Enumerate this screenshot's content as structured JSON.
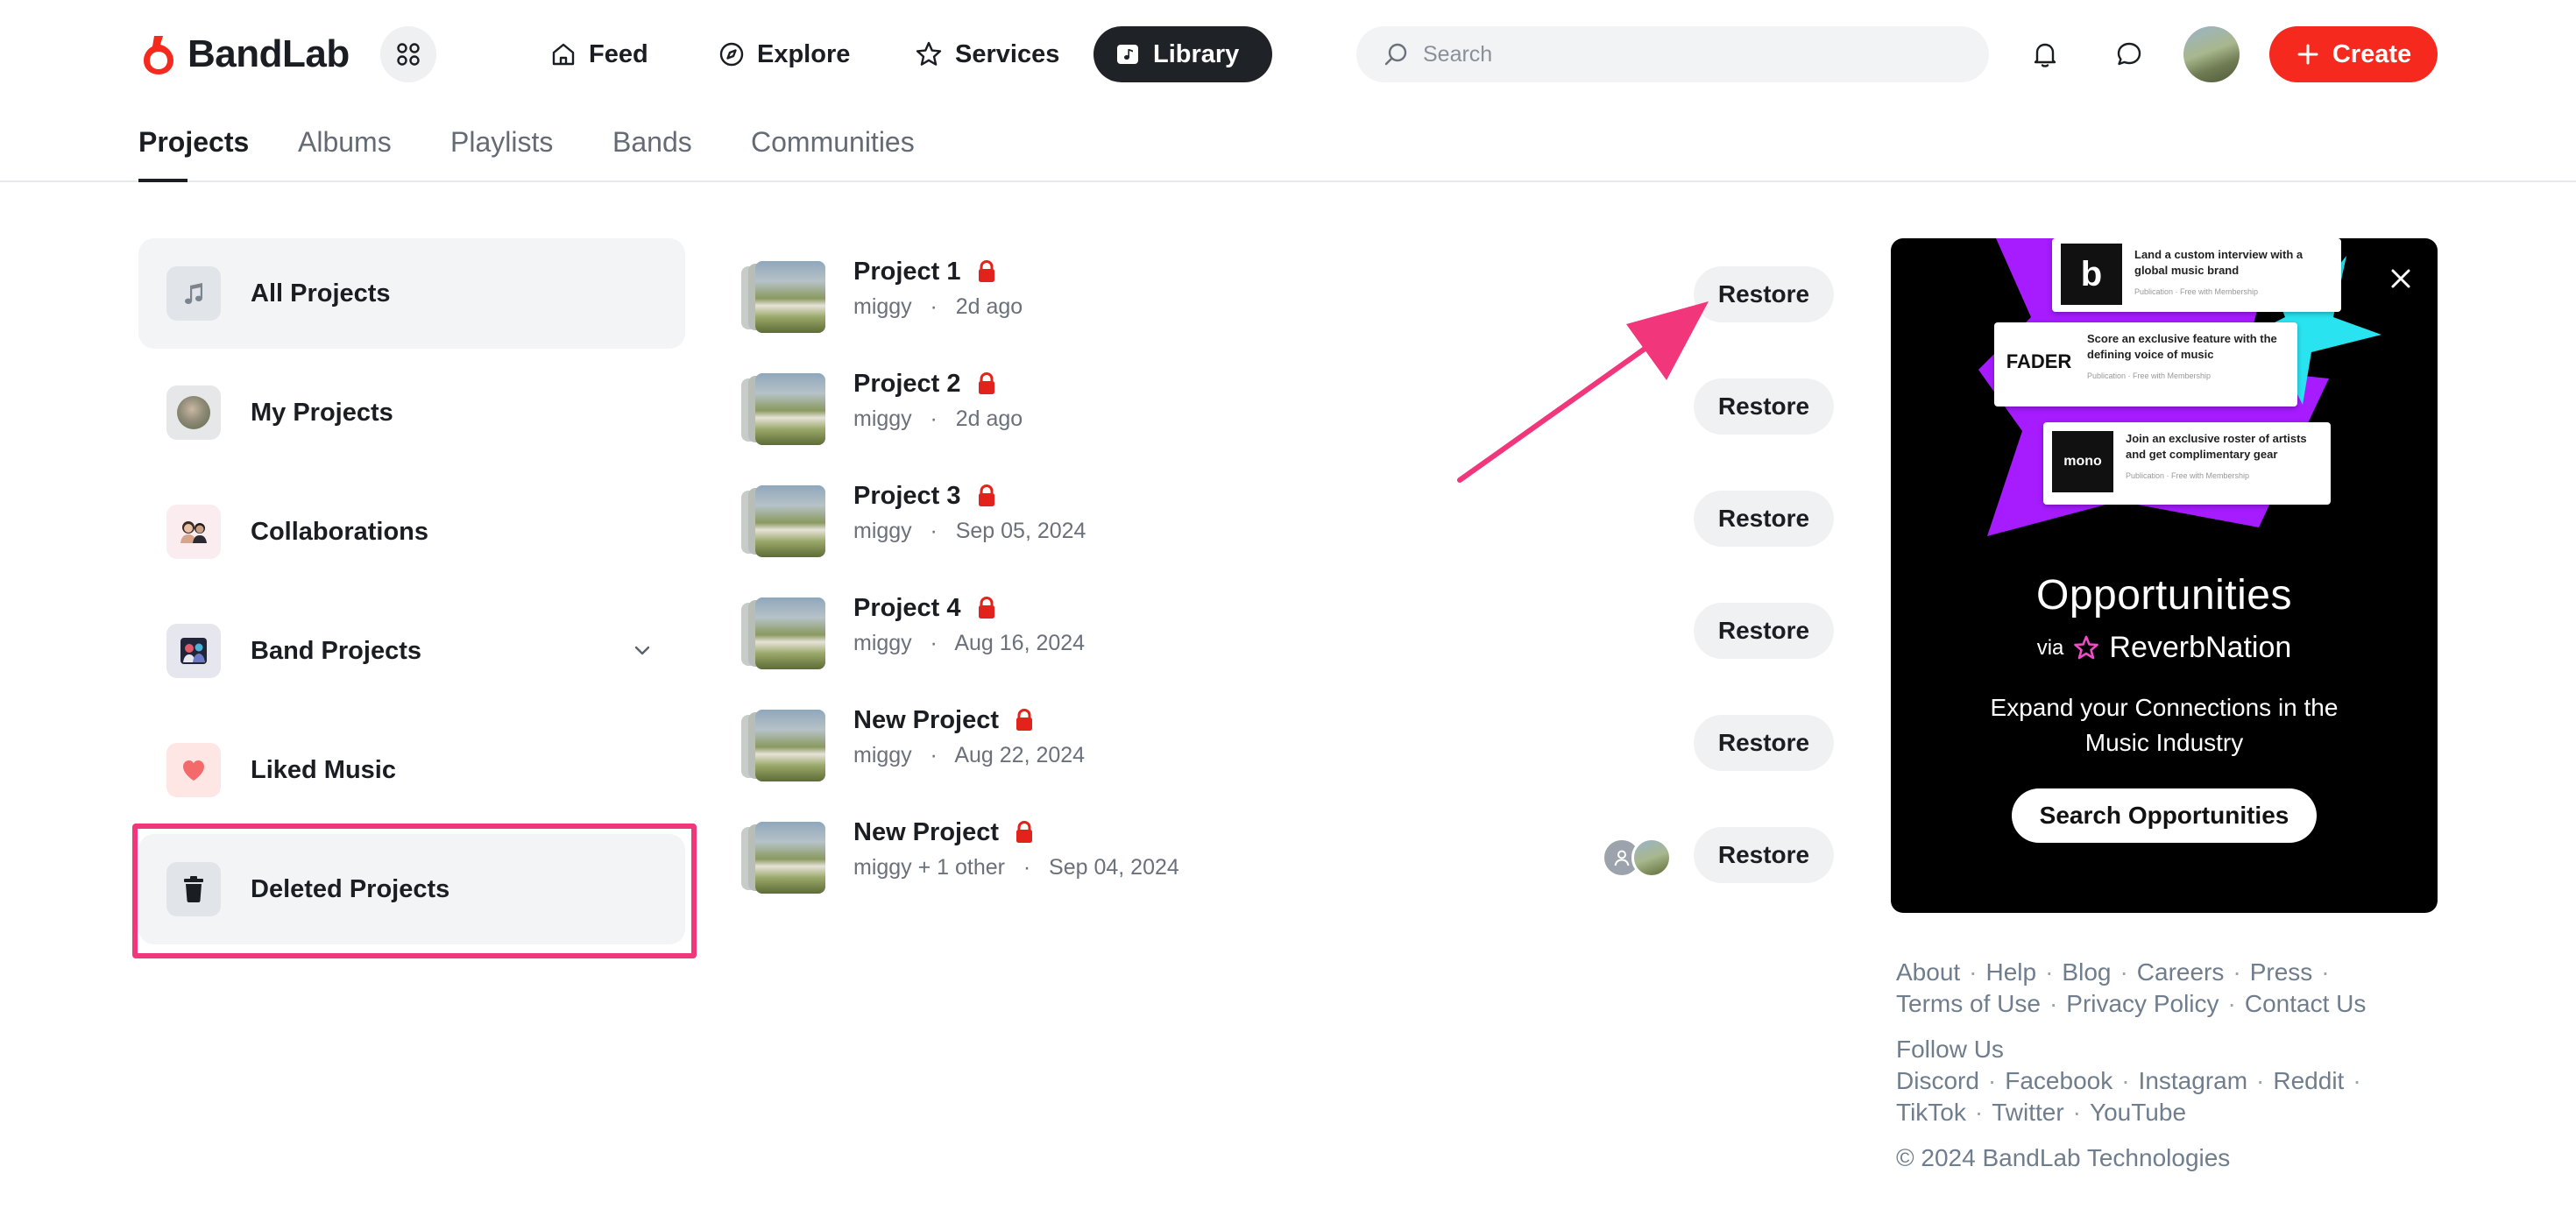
{
  "app": {
    "brand": "BandLab",
    "brand_color": "#f5291d"
  },
  "nav": {
    "items": [
      {
        "label": "Feed",
        "icon": "home-icon",
        "active": false
      },
      {
        "label": "Explore",
        "icon": "compass-icon",
        "active": false
      },
      {
        "label": "Services",
        "icon": "star-icon",
        "active": false
      },
      {
        "label": "Library",
        "icon": "library-icon",
        "active": true
      }
    ],
    "search_placeholder": "Search",
    "create_label": "Create"
  },
  "tabs": [
    {
      "label": "Projects",
      "active": true
    },
    {
      "label": "Albums",
      "active": false
    },
    {
      "label": "Playlists",
      "active": false
    },
    {
      "label": "Bands",
      "active": false
    },
    {
      "label": "Communities",
      "active": false
    }
  ],
  "sidebar": {
    "items": [
      {
        "label": "All Projects",
        "icon": "music-note-icon",
        "selected": true
      },
      {
        "label": "My Projects",
        "icon": "user-avatar-icon",
        "selected": false
      },
      {
        "label": "Collaborations",
        "icon": "collaborators-icon",
        "selected": false
      },
      {
        "label": "Band Projects",
        "icon": "band-icon",
        "selected": false,
        "expandable": true
      },
      {
        "label": "Liked Music",
        "icon": "heart-icon",
        "selected": false
      },
      {
        "label": "Deleted Projects",
        "icon": "trash-icon",
        "selected": false,
        "highlighted": true
      }
    ]
  },
  "projects": [
    {
      "title": "Project 1",
      "owner": "miggy",
      "date": "2d ago",
      "private": true,
      "restore_label": "Restore"
    },
    {
      "title": "Project 2",
      "owner": "miggy",
      "date": "2d ago",
      "private": true,
      "restore_label": "Restore"
    },
    {
      "title": "Project 3",
      "owner": "miggy",
      "date": "Sep 05, 2024",
      "private": true,
      "restore_label": "Restore"
    },
    {
      "title": "Project 4",
      "owner": "miggy",
      "date": "Aug 16, 2024",
      "private": true,
      "restore_label": "Restore"
    },
    {
      "title": "New Project",
      "owner": "miggy",
      "date": "Aug 22, 2024",
      "private": true,
      "restore_label": "Restore"
    },
    {
      "title": "New Project",
      "owner": "miggy + 1 other",
      "date": "Sep 04, 2024",
      "private": true,
      "restore_label": "Restore",
      "collaborators": true
    }
  ],
  "meta_separator": "·",
  "promo": {
    "cards": [
      {
        "logo": "b",
        "text": "Land a custom interview with a global music brand",
        "sub": "Publication · Free with Membership"
      },
      {
        "logo": "FADER",
        "text": "Score an exclusive feature with the defining voice of music",
        "sub": "Publication · Free with Membership"
      },
      {
        "logo": "mono",
        "text": "Join an exclusive roster of artists and get complimentary gear",
        "sub": "Publication · Free with Membership"
      }
    ],
    "title": "Opportunities",
    "via": "via",
    "via_brand": "ReverbNation",
    "description": "Expand your Connections in the Music Industry",
    "button_label": "Search Opportunities",
    "accent_purple": "#a61bff",
    "accent_cyan": "#29e3f0",
    "accent_pink": "#f04cc8"
  },
  "footer": {
    "row1": [
      "About",
      "Help",
      "Blog",
      "Careers",
      "Press"
    ],
    "row2": [
      "Terms of Use",
      "Privacy Policy",
      "Contact Us"
    ],
    "follow_label": "Follow Us",
    "row3": [
      "Discord",
      "Facebook",
      "Instagram",
      "Reddit"
    ],
    "row4": [
      "TikTok",
      "Twitter",
      "YouTube"
    ],
    "copyright": "© 2024 BandLab Technologies"
  },
  "annotation_color": "#f1367c"
}
